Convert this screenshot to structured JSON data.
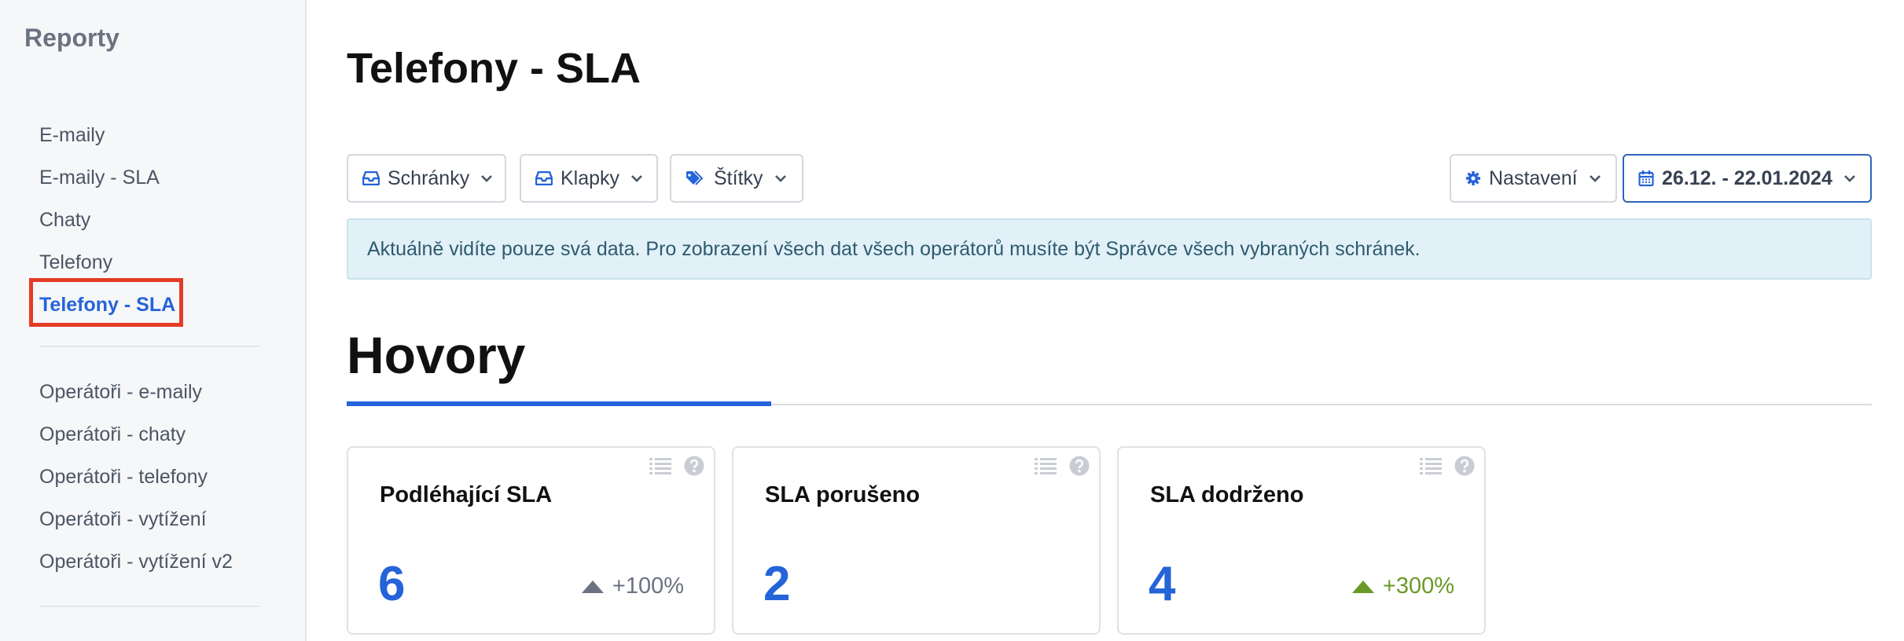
{
  "sidebar": {
    "title": "Reporty",
    "group1": [
      {
        "label": "E-maily"
      },
      {
        "label": "E-maily - SLA"
      },
      {
        "label": "Chaty"
      },
      {
        "label": "Telefony"
      },
      {
        "label": "Telefony - SLA"
      }
    ],
    "group2": [
      {
        "label": "Operátoři - e-maily"
      },
      {
        "label": "Operátoři - chaty"
      },
      {
        "label": "Operátoři - telefony"
      },
      {
        "label": "Operátoři - vytížení"
      },
      {
        "label": "Operátoři - vytížení v2"
      }
    ]
  },
  "page": {
    "title": "Telefony - SLA"
  },
  "filters": {
    "schranky": "Schránky",
    "klapky": "Klapky",
    "stitky": "Štítky",
    "nastaveni": "Nastavení",
    "date_range": "26.12. - 22.01.2024"
  },
  "alert": {
    "text": "Aktuálně vidíte pouze svá data. Pro zobrazení všech dat všech operátorů musíte být Správce všech vybraných schránek."
  },
  "section": {
    "title": "Hovory"
  },
  "cards": [
    {
      "title": "Podléhající SLA",
      "value": "6",
      "trend": "+100%",
      "trend_color": "#6b7280"
    },
    {
      "title": "SLA porušeno",
      "value": "2",
      "trend": "",
      "trend_color": "#6b7280"
    },
    {
      "title": "SLA dodrženo",
      "value": "4",
      "trend": "+300%",
      "trend_color": "#6a9a26"
    }
  ],
  "colors": {
    "accent": "#2563d8",
    "highlight_border": "#e43b25",
    "alert_bg": "#e2f1f8",
    "trend_positive": "#6a9a26",
    "trend_neutral": "#6b7280"
  }
}
